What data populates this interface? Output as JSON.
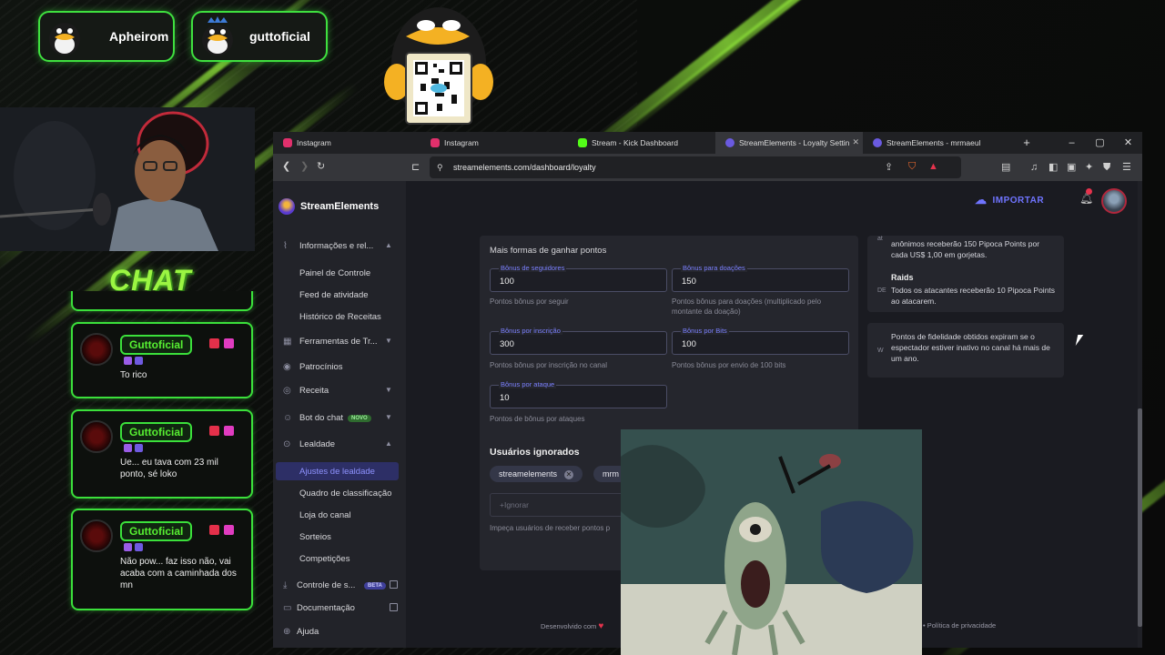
{
  "streamers": [
    "Apheirom",
    "guttoficial"
  ],
  "chat": {
    "title": "CHAT",
    "messages": [
      {
        "user": "Guttoficial",
        "text": "To rico"
      },
      {
        "user": "Guttoficial",
        "text": "Ue... eu tava com 23 mil ponto, sé loko"
      },
      {
        "user": "Guttoficial",
        "text": "Não pow... faz isso não, vai acaba com a caminhada dos mn"
      }
    ]
  },
  "browser": {
    "tabs": [
      {
        "label": "Instagram",
        "color": "#e1306c"
      },
      {
        "label": "Instagram",
        "color": "#e1306c"
      },
      {
        "label": "Stream - Kick Dashboard",
        "color": "#53fc18"
      },
      {
        "label": "StreamElements - Loyalty Settin",
        "color": "#6a5ae0"
      },
      {
        "label": "StreamElements - mrmaeul",
        "color": "#6a5ae0"
      }
    ],
    "url": "streamelements.com/dashboard/loyalty"
  },
  "sidebar": {
    "brand": "StreamElements",
    "groups": [
      {
        "label": "Informações e rel..."
      },
      {
        "label": "Ferramentas de Tr..."
      },
      {
        "label": "Patrocínios"
      },
      {
        "label": "Receita"
      },
      {
        "label": "Bot do chat",
        "badge": "NOVO"
      },
      {
        "label": "Lealdade"
      },
      {
        "label": "Controle de s...",
        "badge": "BETA"
      },
      {
        "label": "Documentação"
      },
      {
        "label": "Ajuda"
      }
    ],
    "info_items": [
      "Painel de Controle",
      "Feed de atividade",
      "Histórico de Receitas"
    ],
    "loyalty_items": [
      "Ajustes de lealdade",
      "Quadro de classificação",
      "Loja do canal",
      "Sorteios",
      "Competições"
    ]
  },
  "header": {
    "import_label": "IMPORTAR"
  },
  "loyalty": {
    "section_title": "Mais formas de ganhar pontos",
    "fields": [
      {
        "label": "Bônus de seguidores",
        "value": "100",
        "hint": "Pontos bônus por seguir"
      },
      {
        "label": "Bônus para doações",
        "value": "150",
        "hint": "Pontos bônus para doações (multiplicado pelo montante da doação)"
      },
      {
        "label": "Bônus por inscrição",
        "value": "300",
        "hint": "Pontos bônus por inscrição no canal"
      },
      {
        "label": "Bônus por Bits",
        "value": "100",
        "hint": "Pontos bônus por envio de 100 bits"
      },
      {
        "label": "Bônus por ataque",
        "value": "10",
        "hint": "Pontos de bônus por ataques"
      }
    ],
    "ignored_title": "Usuários ignorados",
    "ignored_chips": [
      "streamelements",
      "mrm"
    ],
    "ignore_placeholder": "+Ignorar",
    "ignore_hint": "Impeça usuários de receber pontos p"
  },
  "right_info": {
    "tip_text": "anônimos receberão 150 Pipoca Points por cada US$ 1,00 em gorjetas.",
    "tip_side": "at",
    "raids_title": "Raids",
    "raids_text": "Todos os atacantes receberão 10 Pipoca Points ao atacarem.",
    "raids_side": "DE",
    "expire_text": "Pontos de fidelidade obtidos expiram se o espectador estiver inativo no canal há mais de um ano.",
    "expire_side": "W"
  },
  "footer": {
    "left": "Desenvolvido com",
    "right": "• Política de privacidade"
  }
}
